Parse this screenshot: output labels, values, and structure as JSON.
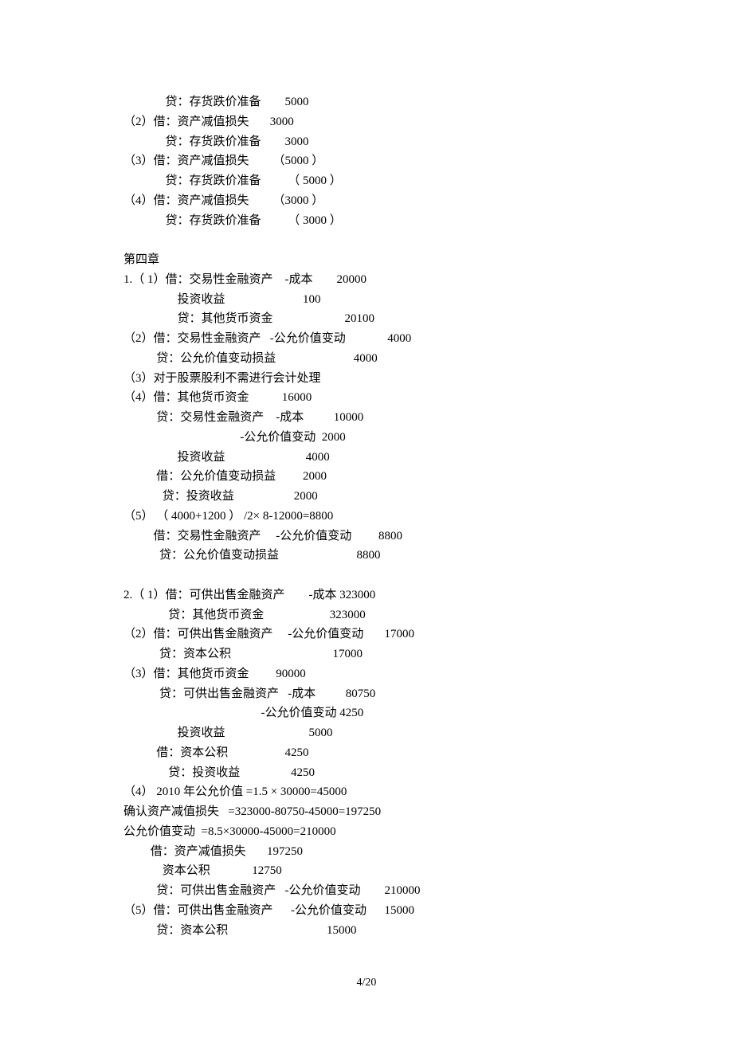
{
  "lines": [
    "              贷：存货跌价准备        5000",
    "（2）借：资产减值损失       3000",
    "              贷：存货跌价准备        3000",
    "（3）借：资产减值损失        （5000 ）",
    "              贷：存货跌价准备         （ 5000 ）",
    "（4）借：资产减值损失        （3000 ）",
    "              贷：存货跌价准备         （ 3000 ）",
    "",
    "第四章",
    "1.（ 1）借：交易性金融资产    -成本        20000",
    "                  投资收益                          100",
    "                  贷：其他货币资金                        20100",
    "（2）借：交易性金融资产   -公允价值变动              4000",
    "           贷：公允价值变动损益                          4000",
    "（3）对于股票股利不需进行会计处理",
    "（4）借：其他货币资金           16000",
    "           贷：交易性金融资产    -成本          10000",
    "                                       -公允价值变动  2000",
    "                  投资收益                           4000",
    "           借：公允价值变动损益         2000",
    "             贷：投资收益                    2000",
    "（5） （ 4000+1200 ） /2× 8-12000=8800",
    "          借：交易性金融资产     -公允价值变动         8800",
    "            贷：公允价值变动损益                          8800",
    "",
    "2.（ 1）借：可供出售金融资产        -成本 323000",
    "               贷：其他货币资金                      323000",
    "（2）借：可供出售金融资产     -公允价值变动       17000",
    "            贷：资本公积                                  17000",
    "（3）借：其他货币资金         90000",
    "            贷：可供出售金融资产   -成本          80750",
    "                                              -公允价值变动 4250",
    "                  投资收益                            5000",
    "           借：资本公积                   4250",
    "               贷：投资收益                 4250",
    "（4） 2010 年公允价值 =1.5 × 30000=45000",
    "确认资产减值损失   =323000-80750-45000=197250",
    "公允价值变动  =8.5×30000-45000=210000",
    "         借：资产减值损失       197250",
    "             资本公积              12750",
    "           贷：可供出售金融资产   -公允价值变动        210000",
    "（5）借：可供出售金融资产      -公允价值变动      15000",
    "           贷：资本公积                                 15000"
  ],
  "pageNumber": "4/20"
}
